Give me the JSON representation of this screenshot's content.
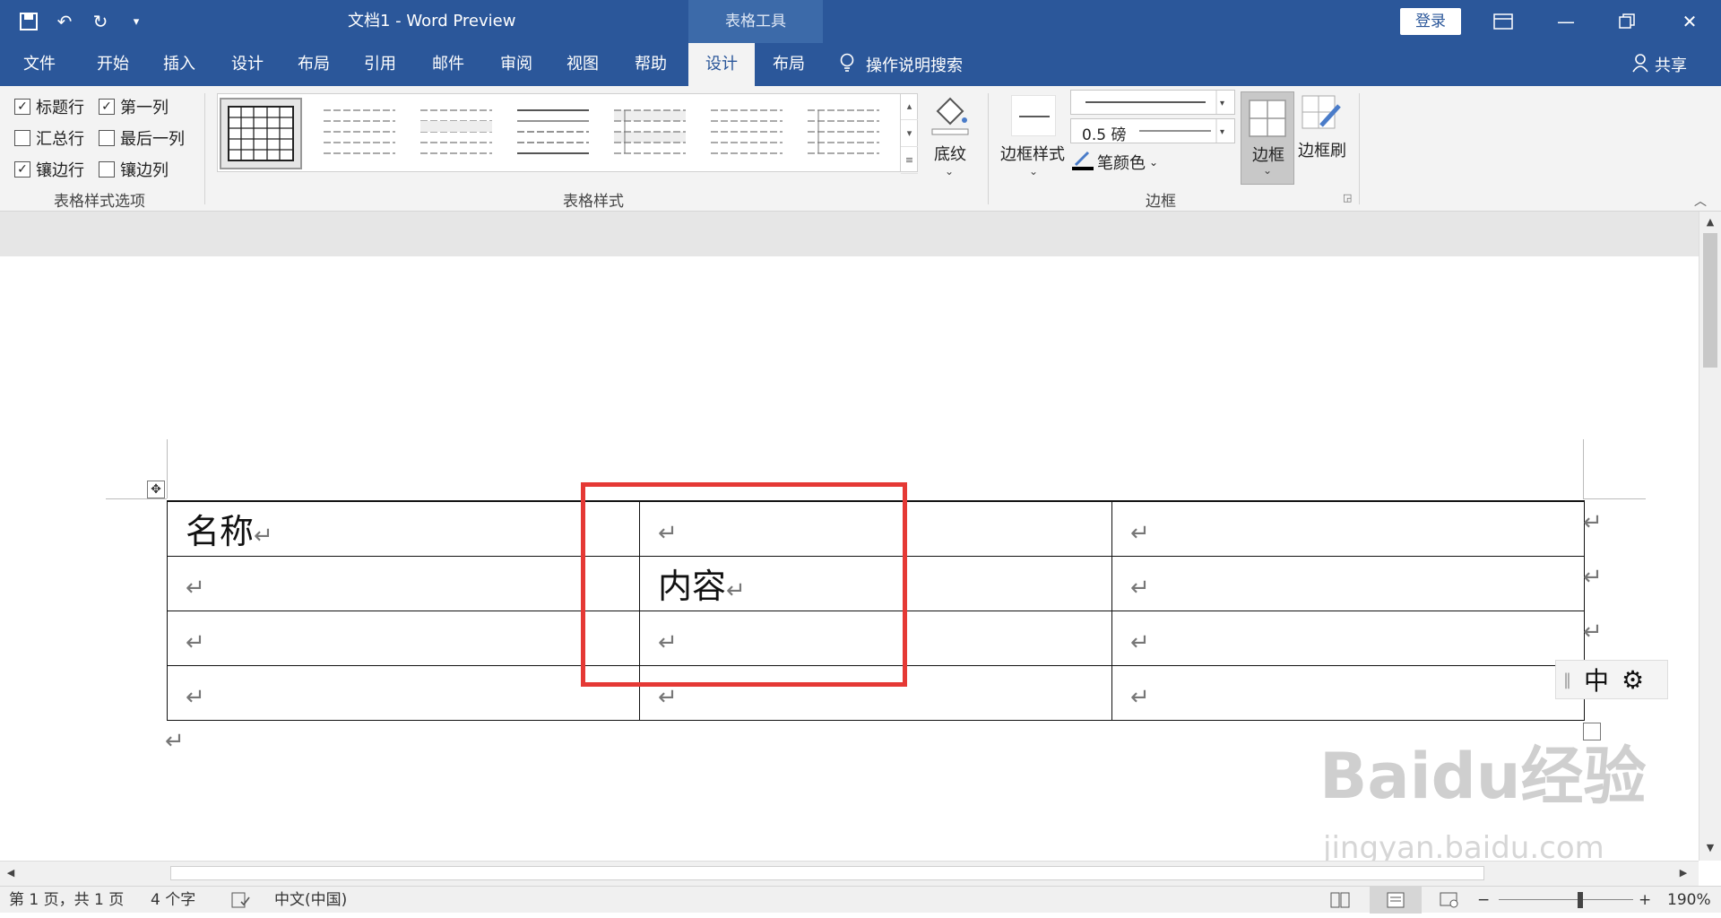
{
  "titlebar": {
    "doc_title": "文档1  -  Word Preview",
    "context_tab": "表格工具",
    "login": "登录",
    "qat_icons": [
      "save-icon",
      "undo-icon",
      "redo-icon",
      "customize-icon"
    ]
  },
  "tabs": [
    {
      "label": "文件"
    },
    {
      "label": "开始"
    },
    {
      "label": "插入"
    },
    {
      "label": "设计"
    },
    {
      "label": "布局"
    },
    {
      "label": "引用"
    },
    {
      "label": "邮件"
    },
    {
      "label": "审阅"
    },
    {
      "label": "视图"
    },
    {
      "label": "帮助"
    },
    {
      "label": "设计",
      "active": true
    },
    {
      "label": "布局"
    }
  ],
  "tellme": "操作说明搜索",
  "share": "共享",
  "ribbon": {
    "options": [
      {
        "label": "标题行",
        "checked": true
      },
      {
        "label": "第一列",
        "checked": true
      },
      {
        "label": "汇总行",
        "checked": false
      },
      {
        "label": "最后一列",
        "checked": false
      },
      {
        "label": "镶边行",
        "checked": true
      },
      {
        "label": "镶边列",
        "checked": false
      }
    ],
    "group_options": "表格样式选项",
    "group_styles": "表格样式",
    "shading": "底纹",
    "border_styles": "边框样式",
    "pen_weight": "0.5 磅",
    "pen_color": "笔颜色",
    "borders": "边框",
    "border_painter": "边框刷",
    "group_borders": "边框"
  },
  "document": {
    "table": [
      [
        "名称",
        "",
        ""
      ],
      [
        "",
        "内容",
        ""
      ],
      [
        "",
        "",
        ""
      ],
      [
        "",
        "",
        ""
      ]
    ],
    "paragraph_mark": "↵"
  },
  "ime": {
    "mode": "中"
  },
  "watermark": {
    "logo": "Baidu经验",
    "url": "jingyan.baidu.com"
  },
  "status": {
    "page": "第 1 页，共 1 页",
    "words": "4 个字",
    "language": "中文(中国)",
    "zoom": "190%"
  },
  "colors": {
    "accent": "#2b579a",
    "highlight": "#e53935"
  }
}
